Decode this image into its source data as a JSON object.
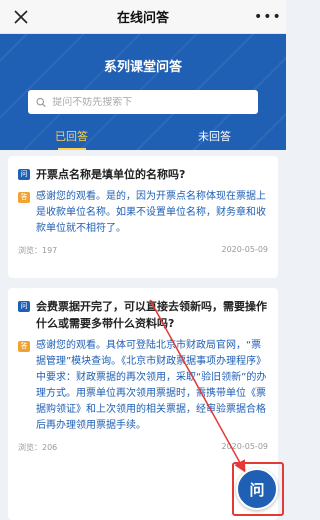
{
  "topbar": {
    "title": "在线问答",
    "more": "•••",
    "close_icon": "close-icon"
  },
  "hero": {
    "title": "系列课堂问答",
    "search_placeholder": "提问不妨先搜索下",
    "tabs": [
      {
        "label": "已回答",
        "active": true
      },
      {
        "label": "未回答",
        "active": false
      }
    ]
  },
  "badges": {
    "question": "问",
    "answer": "答"
  },
  "cards": [
    {
      "question": "开票点名称是填单位的名称吗?",
      "answer": "感谢您的观看。是的，因为开票点名称体现在票据上是收款单位名称。如果不设置单位名称，财务章和收款单位就不相符了。",
      "views": "浏览：197",
      "date": "2020-05-09"
    },
    {
      "question": "会费票据开完了，可以直接去领新吗，需要操作什么或需要多带什么资料吗?",
      "answer": "感谢您的观看。具体可登陆北京市财政局官网，“票据管理”模块查询。《北京市财政票据事项办理程序》中要求：财政票据的再次领用，采取“验旧领新”的办理方式。用票单位再次领用票据时，需携带单位《票据购领证》和上次领用的相关票据，经审验票据合格后再办理领用票据手续。",
      "views": "浏览：206",
      "date": "2020-05-09"
    }
  ],
  "fab": {
    "label": "问"
  },
  "colors": {
    "primary": "#1f5fb4",
    "accent": "#ffd34d",
    "answer_badge": "#f0a330",
    "annotation": "#e53935"
  }
}
